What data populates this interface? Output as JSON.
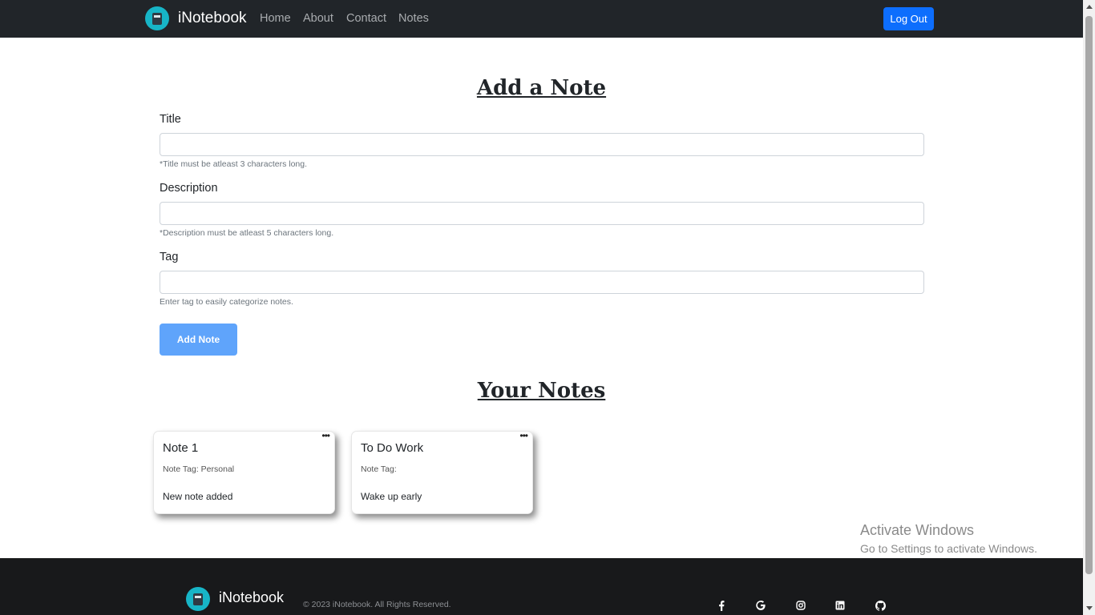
{
  "navbar": {
    "brand": "iNotebook",
    "links": [
      "Home",
      "About",
      "Contact",
      "Notes"
    ],
    "logout_label": "Log Out"
  },
  "form": {
    "heading": "Add a Note",
    "title_label": "Title",
    "title_value": "",
    "title_hint": "*Title must be atleast 3 characters long.",
    "description_label": "Description",
    "description_value": "",
    "description_hint": "*Description must be atleast 5 characters long.",
    "tag_label": "Tag",
    "tag_value": "",
    "tag_hint": "Enter tag to easily categorize notes.",
    "submit_label": "Add Note"
  },
  "notes": {
    "heading": "Your Notes",
    "items": [
      {
        "title": "Note 1",
        "tag": "Note Tag: Personal",
        "description": "New note added",
        "menu": "•••"
      },
      {
        "title": "To Do Work",
        "tag": "Note Tag:",
        "description": "Wake up early",
        "menu": "•••"
      }
    ]
  },
  "watermark": {
    "title": "Activate Windows",
    "subtitle": "Go to Settings to activate Windows."
  },
  "footer": {
    "brand": "iNotebook",
    "copyright": "© 2023 iNotebook. All Rights Reserved.",
    "social_icons": [
      "facebook-icon",
      "google-icon",
      "instagram-icon",
      "linkedin-icon",
      "github-icon"
    ]
  },
  "colors": {
    "navbar_bg": "#212529",
    "primary": "#0d6efd",
    "add_button": "#5fa4fb",
    "logo": "#17b5c7",
    "footer_bg": "#18191b"
  }
}
